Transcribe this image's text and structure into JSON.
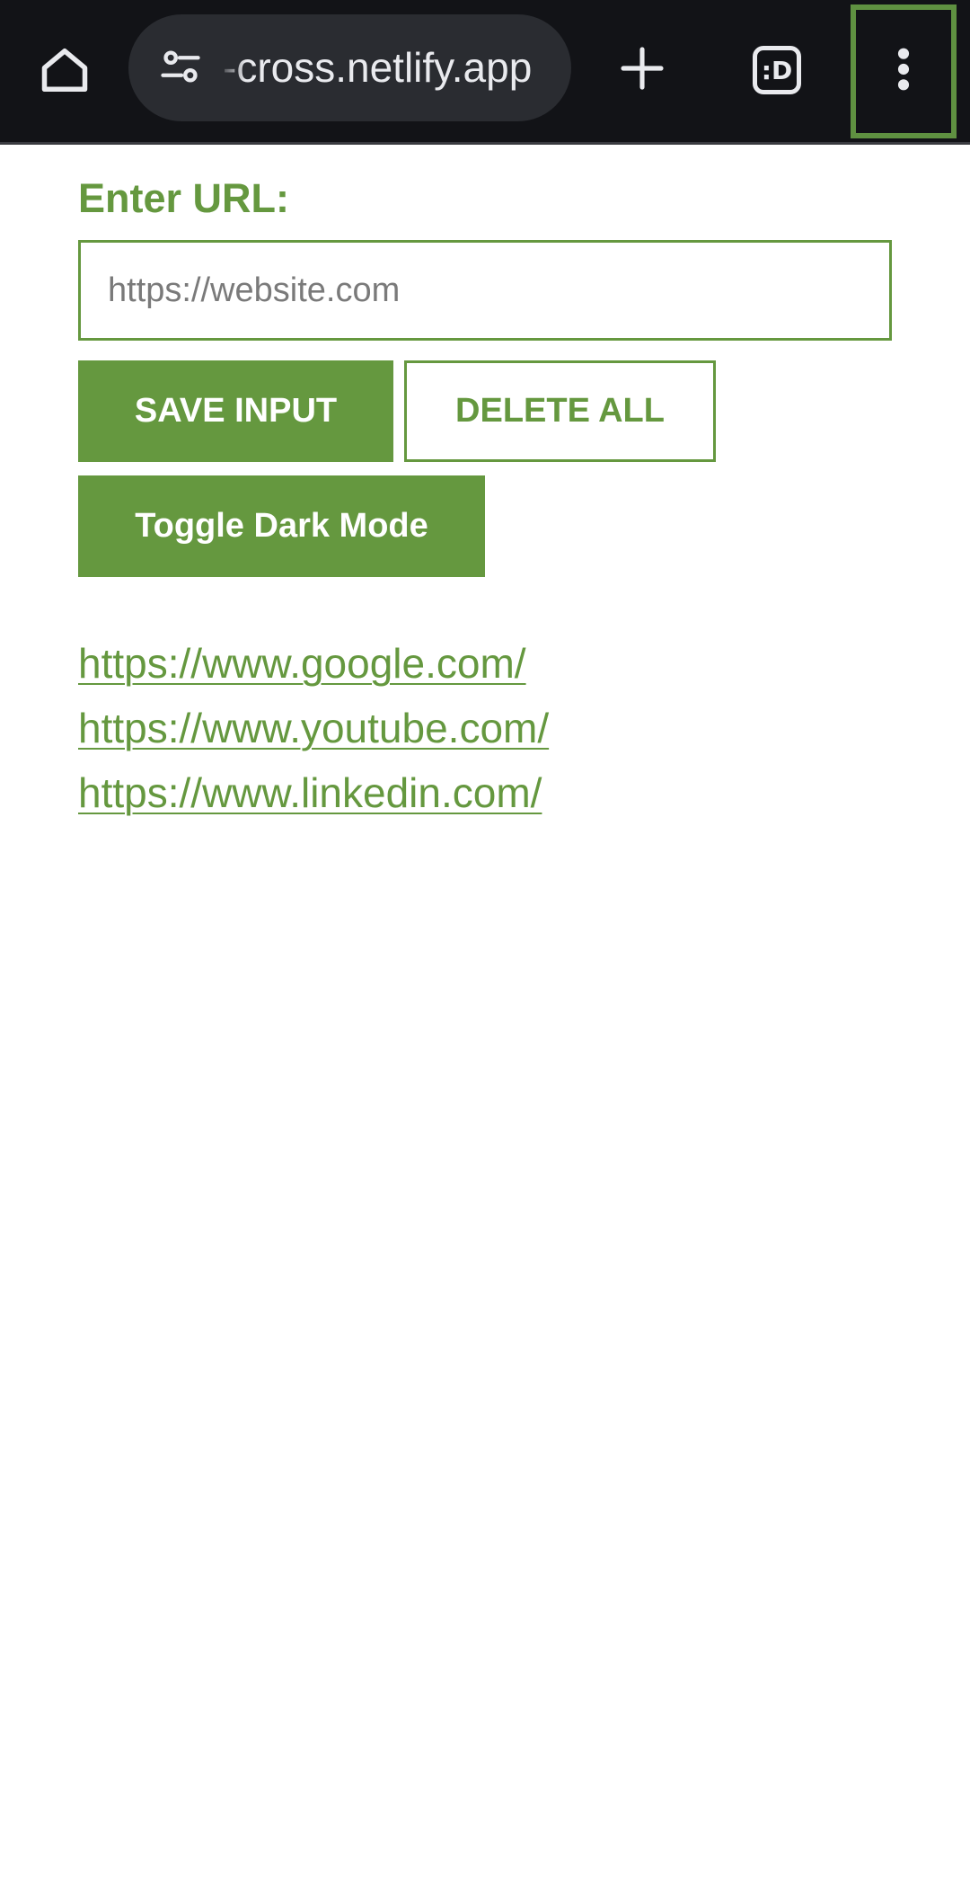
{
  "browser": {
    "url_display": "-cross.netlify.app",
    "tab_count": ":D",
    "home_icon": "home-icon",
    "site_settings_icon": "tune-icon",
    "new_tab_icon": "plus-icon",
    "menu_icon": "more-vertical-icon",
    "highlight_color": "#5f9141"
  },
  "app": {
    "label": "Enter URL:",
    "input": {
      "value": "",
      "placeholder": "https://website.com"
    },
    "buttons": {
      "save": "SAVE INPUT",
      "delete": "DELETE ALL",
      "toggle_dark": "Toggle Dark Mode"
    },
    "links": [
      "https://www.google.com/",
      "https://www.youtube.com/",
      "https://www.linkedin.com/"
    ],
    "accent_color": "#65983f"
  }
}
